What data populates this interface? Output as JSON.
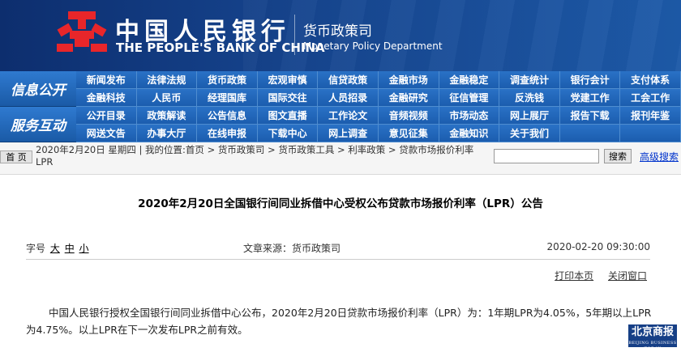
{
  "header": {
    "bank_cn": "中国人民银行",
    "bank_en": "THE PEOPLE'S BANK OF CHINA",
    "dept_cn": "货币政策司",
    "dept_en": "Monetary Policy Department"
  },
  "nav": {
    "section1_label": "信息公开",
    "section2_label": "服务互动",
    "items": [
      "新闻发布",
      "法律法规",
      "货币政策",
      "宏观审慎",
      "信贷政策",
      "金融市场",
      "金融稳定",
      "调查统计",
      "银行会计",
      "支付体系",
      "金融科技",
      "人民币",
      "经理国库",
      "国际交往",
      "人员招录",
      "金融研究",
      "征信管理",
      "反洗钱",
      "党建工作",
      "工会工作",
      "公开目录",
      "政策解读",
      "公告信息",
      "图文直播",
      "工作论文",
      "音频视频",
      "市场动态",
      "网上展厅",
      "报告下载",
      "报刊年鉴",
      "网送文告",
      "办事大厅",
      "在线申报",
      "下载中心",
      "网上调查",
      "意见征集",
      "金融知识",
      "关于我们",
      "",
      ""
    ]
  },
  "breadcrumb": {
    "home_button": "首 页",
    "text": "2020年2月20日 星期四 | 我的位置:首页 > 货币政策司 > 货币政策工具 > 利率政策 > 贷款市场报价利率LPR",
    "search_button": "搜索",
    "advanced_search": "高级搜索",
    "search_value": ""
  },
  "article": {
    "title": "2020年2月20日全国银行间同业拆借中心受权公布贷款市场报价利率（LPR）公告",
    "font_size_label": "字号",
    "font_sizes": [
      "大",
      "中",
      "小"
    ],
    "source": "文章来源：货币政策司",
    "date": "2020-02-20 09:30:00",
    "print_label": "打印本页",
    "close_label": "关闭窗口",
    "body": "中国人民银行授权全国银行间同业拆借中心公布，2020年2月20日贷款市场报价利率（LPR）为：1年期LPR为4.05%，5年期以上LPR为4.75%。以上LPR在下一次发布LPR之前有效。"
  },
  "watermark": {
    "text": "北京商报",
    "sub": "BEIJING BUSINESS TODAY"
  },
  "colors": {
    "banner": "#16458f",
    "nav": "#1b5dae",
    "link": "#0033cc"
  }
}
